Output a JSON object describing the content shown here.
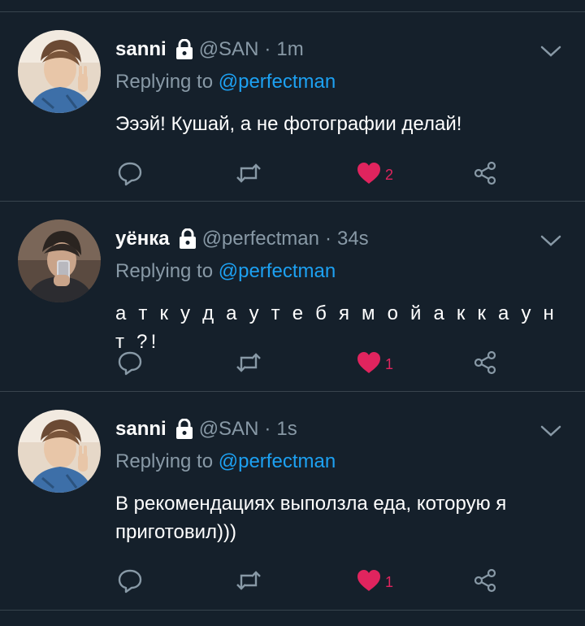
{
  "tweets": [
    {
      "name": "sanni",
      "handle": "@SAN",
      "time": "1m",
      "reply_prefix": "Replying to",
      "reply_to": "@perfectman",
      "text": "Эээй! Кушай, а не фотографии делай!",
      "likes": "2",
      "liked": true,
      "avatar": "person-with-peace-sign"
    },
    {
      "name": "уёнка",
      "handle": "@perfectman",
      "time": "34s",
      "reply_prefix": "Replying to",
      "reply_to": "@perfectman",
      "text": "а т к у д а у т е б я м о й а к к а у н т ?!",
      "likes": "1",
      "liked": true,
      "avatar": "person-taking-mirror-selfie"
    },
    {
      "name": "sanni",
      "handle": "@SAN",
      "time": "1s",
      "reply_prefix": "Replying to",
      "reply_to": "@perfectman",
      "text": "В рекомендациях выползла еда, которую я приготовил)))",
      "likes": "1",
      "liked": true,
      "avatar": "person-with-peace-sign"
    }
  ],
  "icons": {
    "protected": "lock-icon",
    "menu": "chevron-down-icon",
    "reply": "reply-icon",
    "retweet": "retweet-icon",
    "like": "heart-icon",
    "share": "share-icon"
  },
  "colors": {
    "background": "#15202b",
    "divider": "#38444d",
    "secondary_text": "#8899a6",
    "mention": "#1da1f2",
    "like": "#e0245e"
  }
}
